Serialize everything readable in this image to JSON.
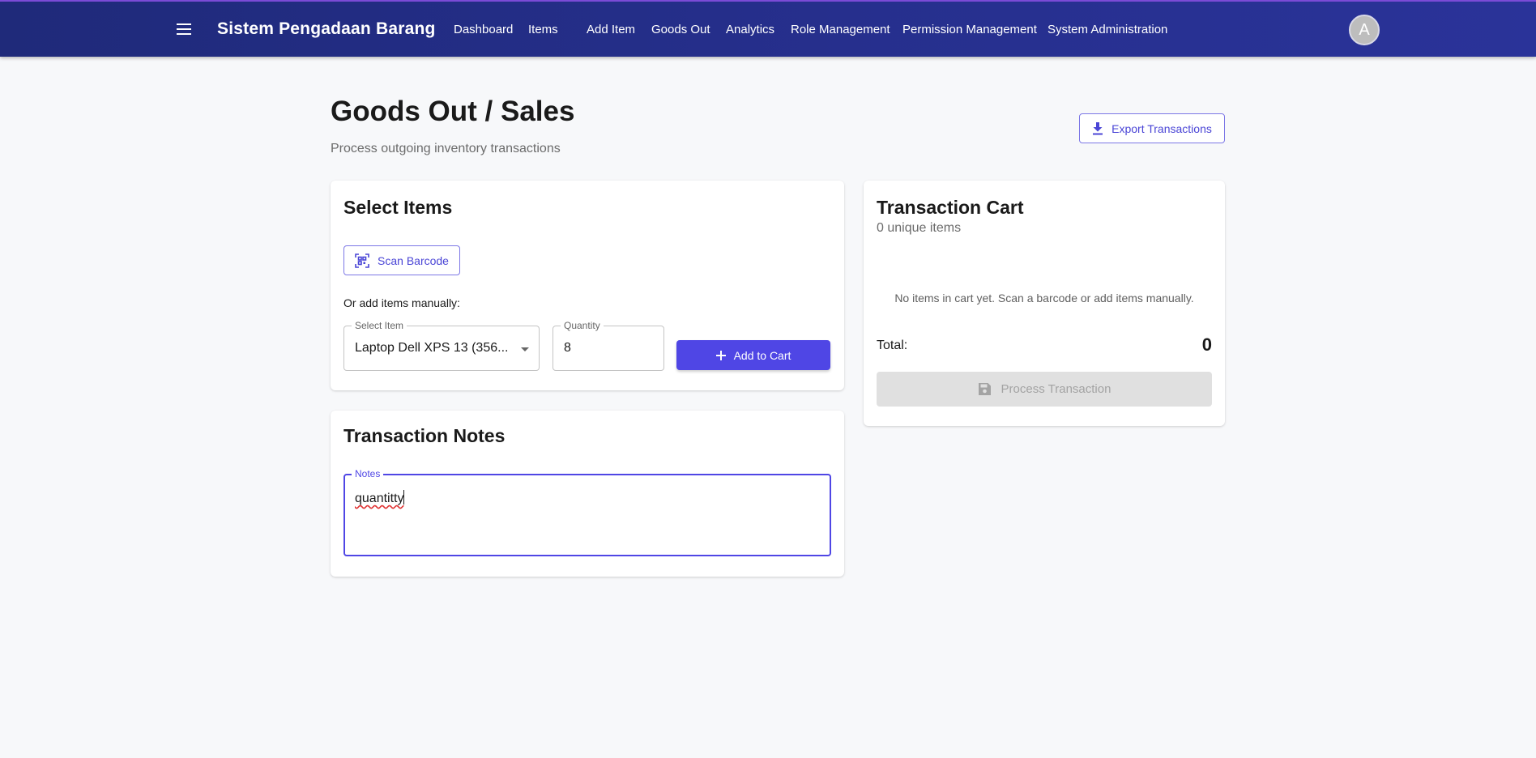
{
  "app": {
    "title": "Sistem Pengadaan Barang",
    "avatar_initial": "A",
    "nav": [
      {
        "label": "Dashboard"
      },
      {
        "label": "Items"
      },
      {
        "label": "Add Item"
      },
      {
        "label": "Goods Out"
      },
      {
        "label": "Analytics"
      },
      {
        "label": "Role Management"
      },
      {
        "label": "Permission Management"
      },
      {
        "label": "System Administration"
      }
    ]
  },
  "page": {
    "title": "Goods Out / Sales",
    "subtitle": "Process outgoing inventory transactions",
    "export_label": "Export Transactions"
  },
  "select_items": {
    "title": "Select Items",
    "scan_label": "Scan Barcode",
    "manual_label": "Or add items manually:",
    "select_label": "Select Item",
    "select_value": "Laptop Dell XPS 13 (356...",
    "quantity_label": "Quantity",
    "quantity_value": "8",
    "add_label": "Add to Cart"
  },
  "notes": {
    "title": "Transaction Notes",
    "label": "Notes",
    "value": "quantitty"
  },
  "cart": {
    "title": "Transaction Cart",
    "count_text": "0 unique items",
    "empty_text": "No items in cart yet. Scan a barcode or add items manually.",
    "total_label": "Total:",
    "total_value": "0",
    "process_label": "Process Transaction"
  },
  "colors": {
    "primary": "#4f46e5",
    "appbar": "#262f8d",
    "spellcheck": "#e03030"
  },
  "icons": [
    "menu-icon",
    "download-icon",
    "qr-scan-icon",
    "plus-icon",
    "save-icon",
    "chevron-down-icon"
  ]
}
